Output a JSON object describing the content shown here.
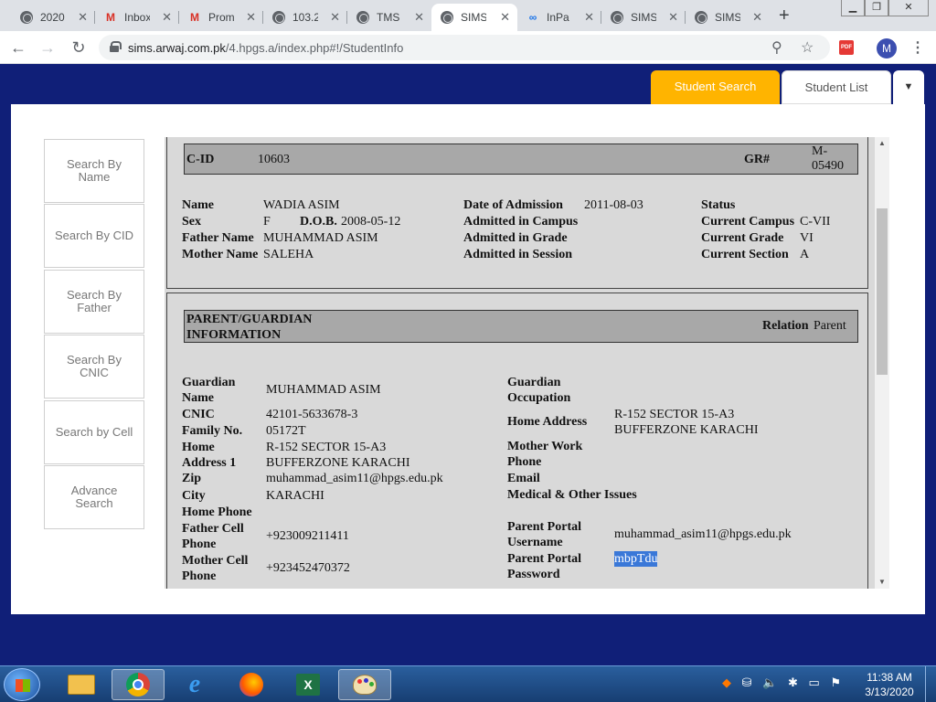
{
  "browser": {
    "tabs": [
      {
        "label": "2020",
        "icon": "globe-icon"
      },
      {
        "label": "Inbox",
        "icon": "gmail-icon"
      },
      {
        "label": "Prom",
        "icon": "gmail-icon"
      },
      {
        "label": "103.2",
        "icon": "globe-icon"
      },
      {
        "label": "TMS",
        "icon": "globe-icon"
      },
      {
        "label": "SIMS",
        "icon": "globe-icon",
        "active": true
      },
      {
        "label": "InPa",
        "icon": "infinity-icon"
      },
      {
        "label": "SIMS",
        "icon": "globe-icon"
      },
      {
        "label": "SIMS",
        "icon": "globe-icon"
      }
    ],
    "url_host": "sims.arwaj.com.pk",
    "url_path": "/4.hpgs.a/index.php#!/StudentInfo",
    "avatar_letter": "M",
    "pdf_badge": "PDF"
  },
  "app": {
    "tab_student_search": "Student Search",
    "tab_student_list": "Student List"
  },
  "sidebar": [
    "Search By Name",
    "Search By CID",
    "Search By Father",
    "Search By CNIC",
    "Search by Cell",
    "Advance Search"
  ],
  "student": {
    "cid_label": "C-ID",
    "cid": "10603",
    "gr_label": "GR#",
    "gr": "M-05490",
    "name_label": "Name",
    "name": "WADIA ASIM",
    "sex_label": "Sex",
    "sex": "F",
    "dob_label": "D.O.B.",
    "dob": "2008-05-12",
    "father_label": "Father Name",
    "father": "MUHAMMAD ASIM",
    "mother_label": "Mother Name",
    "mother": "SALEHA",
    "doa_label": "Date of Admission",
    "doa": "2011-08-03",
    "adm_campus_label": "Admitted in Campus",
    "adm_grade_label": "Admitted in Grade",
    "adm_session_label": "Admitted in Session",
    "status_label": "Status",
    "campus_label": "Current Campus",
    "campus": "C-VII",
    "grade_label": "Current Grade",
    "grade": "VI",
    "section_label": "Current Section",
    "section": "A"
  },
  "guardian": {
    "header": "PARENT/GUARDIAN INFORMATION",
    "relation_label": "Relation",
    "relation": "Parent",
    "g_name_label": "Guardian Name",
    "g_name": "MUHAMMAD ASIM",
    "cnic_label": "CNIC",
    "cnic": "42101-5633678-3",
    "family_label": "Family No.",
    "family": "05172T",
    "home_addr_label": "Home Address 1",
    "home_addr": "R-152 SECTOR 15-A3 BUFFERZONE KARACHI",
    "zip_label": "Zip",
    "zip": "muhammad_asim11@hpgs.edu.pk",
    "city_label": "City",
    "city": "KARACHI",
    "home_phone_label": "Home Phone",
    "father_cell_label": "Father Cell Phone",
    "father_cell": "+923009211411",
    "mother_cell_label": "Mother Cell Phone",
    "mother_cell": "+923452470372",
    "occupation_label": "Guardian Occupation",
    "home_address_label": "Home Address",
    "home_address": "R-152 SECTOR 15-A3 BUFFERZONE KARACHI",
    "mother_work_label": "Mother Work Phone",
    "email_label": "Email",
    "medical_label": "Medical & Other Issues",
    "portal_user_label": "Parent Portal Username",
    "portal_user": "muhammad_asim11@hpgs.edu.pk",
    "portal_pass_label": "Parent Portal Password",
    "portal_pass": "mbpTdu"
  },
  "taskbar": {
    "time": "11:38 AM",
    "date": "3/13/2020"
  }
}
